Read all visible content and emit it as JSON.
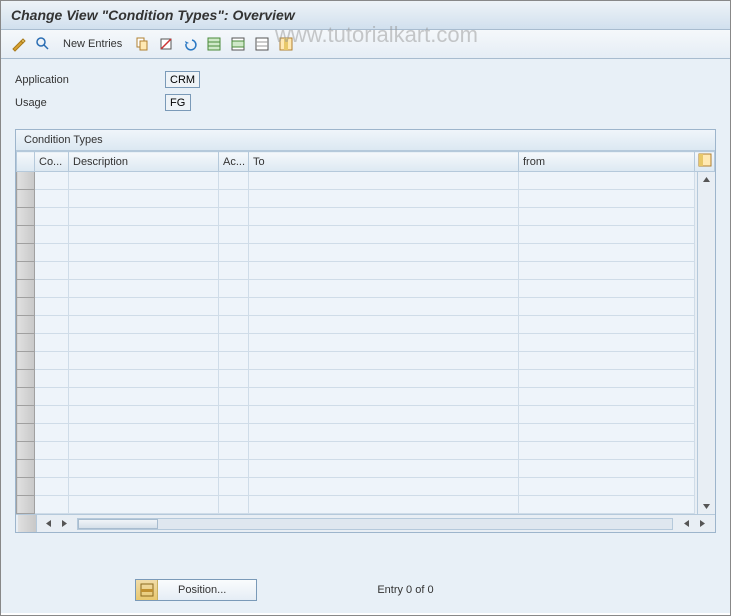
{
  "header": {
    "title": "Change View \"Condition Types\": Overview"
  },
  "toolbar": {
    "new_entries_label": "New Entries"
  },
  "watermark": "www.tutorialkart.com",
  "form": {
    "application_label": "Application",
    "application_value": "CRM",
    "usage_label": "Usage",
    "usage_value": "FG"
  },
  "table": {
    "title": "Condition Types",
    "columns": {
      "co": "Co...",
      "description": "Description",
      "ac": "Ac...",
      "to": "To",
      "from": "from"
    },
    "row_count": 19
  },
  "footer": {
    "position_label": "Position...",
    "entry_text": "Entry 0 of 0"
  }
}
